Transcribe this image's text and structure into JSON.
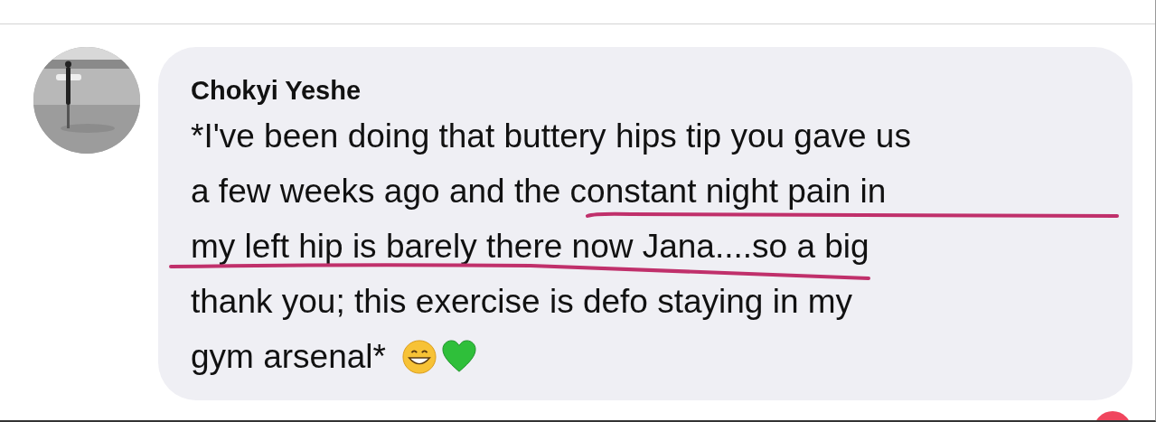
{
  "comment": {
    "author": "Chokyi Yeshe",
    "lines": [
      "*I've been doing that buttery hips tip you gave us",
      "a few weeks ago and the constant night pain in",
      "my left hip is barely there now Jana....so a big",
      "thank you; this exercise is defo staying in my",
      "gym arsenal*"
    ]
  }
}
